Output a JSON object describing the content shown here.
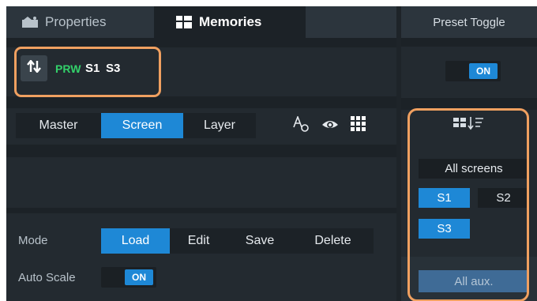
{
  "tabs": {
    "properties": "Properties",
    "memories": "Memories"
  },
  "status": {
    "prw": "PRW",
    "s1": "S1",
    "s3": "S3"
  },
  "segments": {
    "master": "Master",
    "screen": "Screen",
    "layer": "Layer",
    "active": "Screen"
  },
  "icons": {
    "properties_tab": "image-icon",
    "memories_tab": "grid-icon",
    "sort": "sort-icon",
    "font": "font-icon",
    "visibility": "eye-icon",
    "grid": "grid-icon",
    "filter": "filter-icon"
  },
  "mode": {
    "label": "Mode",
    "options": [
      "Load",
      "Edit",
      "Save",
      "Delete"
    ],
    "active": "Load"
  },
  "auto_scale": {
    "label": "Auto Scale",
    "toggle": "ON"
  },
  "preset": {
    "title": "Preset Toggle",
    "toggle": "ON"
  },
  "screens": {
    "all": "All screens",
    "s1": "S1",
    "s2": "S2",
    "s3": "S3",
    "aux": "All aux.",
    "selected": [
      "S1",
      "S3"
    ]
  },
  "colors": {
    "accent": "#1e88d6",
    "highlight": "#f0a060",
    "prw": "#33d06a",
    "panel": "#232a30",
    "background": "#1c2227"
  }
}
